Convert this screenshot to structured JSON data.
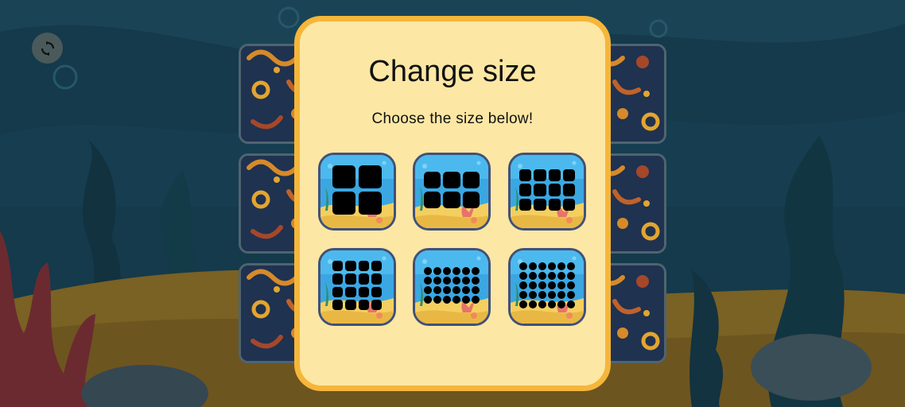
{
  "game": {
    "restart_icon": "refresh-icon",
    "background_cards": 6
  },
  "modal": {
    "title": "Change size",
    "subtitle": "Choose the size below!",
    "options": [
      {
        "id": "2x2",
        "cols": 2,
        "rows": 2
      },
      {
        "id": "3x2",
        "cols": 3,
        "rows": 2
      },
      {
        "id": "4x3",
        "cols": 4,
        "rows": 3
      },
      {
        "id": "4x4",
        "cols": 4,
        "rows": 4
      },
      {
        "id": "6x4",
        "cols": 6,
        "rows": 4
      },
      {
        "id": "6x5",
        "cols": 6,
        "rows": 5
      }
    ]
  },
  "colors": {
    "modal_bg": "#fde7a4",
    "modal_border": "#f5b63a",
    "option_border": "#3f517a",
    "card_back": "#1f3250"
  }
}
